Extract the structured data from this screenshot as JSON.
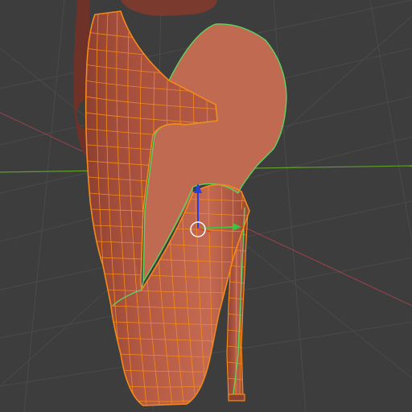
{
  "viewport": {
    "label": "",
    "background": "#3d3d3d",
    "grid_color": "#4a4a4a",
    "x_axis_color": "#b3434f",
    "y_axis_color": "#5f9f2a",
    "wire_color": "#f58a1a",
    "seam_color": "#5fd35f",
    "mesh_fill": "#b85a42"
  },
  "gizmo": {
    "mode": "translate",
    "z_axis_color": "#2a3fe0",
    "x_axis_color": "#e0432a",
    "y_axis_color": "#3fc33f",
    "pivot_color": "#ffffff"
  },
  "object": {
    "type": "high-heel-shoe-mesh",
    "state": "edit-mode-selected"
  }
}
